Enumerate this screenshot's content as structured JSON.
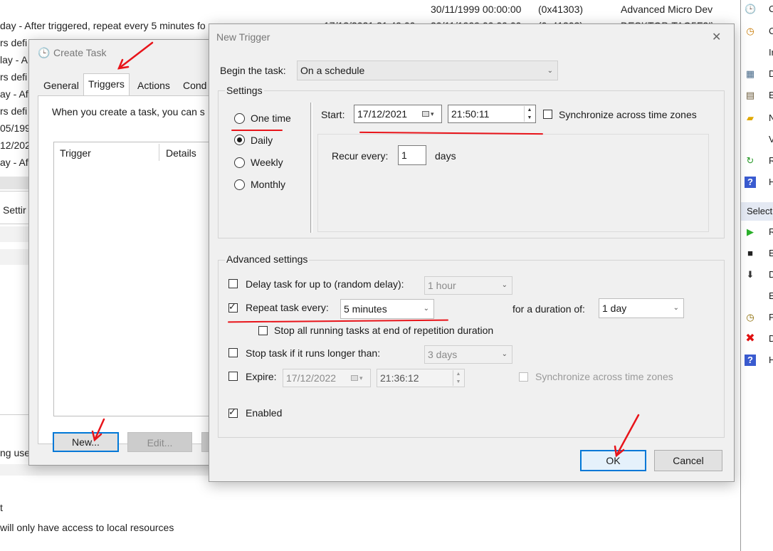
{
  "background": {
    "top_row": {
      "trigger_time": "30/11/1999 00:00:00",
      "result": "(0x41303)",
      "author": "Advanced Micro Dev"
    },
    "row2": {
      "triggers": "day - After triggered, repeat every 5 minutes fo",
      "next_run": "17/12/2021 21:49:00",
      "last_run": "30/11/1999 00:00:00",
      "result": "(0x41303)",
      "author": "DESKTOP-TAQ5F2I\\"
    },
    "left_fragments": [
      "rs defi",
      "lay - A",
      "rs defi",
      "ay - Aft",
      "rs defi",
      "05/199",
      "12/202",
      "ay - Aft"
    ],
    "settings_tab_fragment": "Settir",
    "user_fragment": "ng user",
    "bottom_t": "t",
    "bottom_local": "will only have access to local resources"
  },
  "right_pane": {
    "items": [
      {
        "icon": "clock-icon",
        "text": "C"
      },
      {
        "icon": "task-icon",
        "text": "C"
      },
      {
        "icon": "",
        "text": "Ir"
      },
      {
        "icon": "display-icon",
        "text": "D"
      },
      {
        "icon": "list-icon",
        "text": "E"
      },
      {
        "icon": "folder-icon",
        "text": "N"
      },
      {
        "icon": "",
        "text": "V"
      },
      {
        "icon": "refresh-icon",
        "text": "R"
      },
      {
        "icon": "help-icon",
        "text": "H"
      }
    ],
    "section": "Select",
    "items2": [
      {
        "icon": "run-icon",
        "text": "R"
      },
      {
        "icon": "stop-icon",
        "text": "E"
      },
      {
        "icon": "disable-icon",
        "text": "D"
      },
      {
        "icon": "",
        "text": "E"
      },
      {
        "icon": "properties-icon",
        "text": "P"
      },
      {
        "icon": "delete-icon",
        "text": "D"
      },
      {
        "icon": "help-icon",
        "text": "H"
      }
    ]
  },
  "create_task": {
    "title": "Create Task",
    "tabs": [
      "General",
      "Triggers",
      "Actions",
      "Cond"
    ],
    "active_tab": "Triggers",
    "description": "When you create a task, you can s",
    "columns": [
      "Trigger",
      "Details"
    ],
    "buttons": {
      "new": "New...",
      "edit": "Edit..."
    }
  },
  "new_trigger": {
    "title": "New Trigger",
    "close_glyph": "✕",
    "begin_label": "Begin the task:",
    "begin_value": "On a schedule",
    "settings_label": "Settings",
    "schedule_options": [
      "One time",
      "Daily",
      "Weekly",
      "Monthly"
    ],
    "selected_option": "Daily",
    "start_label": "Start:",
    "start_date": "17/12/2021",
    "start_time": "21:50:11",
    "sync_label": "Synchronize across time zones",
    "recur_label": "Recur every:",
    "recur_value": "1",
    "recur_unit": "days",
    "advanced_label": "Advanced settings",
    "delay_label": "Delay task for up to (random delay):",
    "delay_value": "1 hour",
    "repeat_label": "Repeat task every:",
    "repeat_value": "5 minutes",
    "duration_label": "for a duration of:",
    "duration_value": "1 day",
    "stop_running_label": "Stop all running tasks at end of repetition duration",
    "stop_longer_label": "Stop task if it runs longer than:",
    "stop_longer_value": "3 days",
    "expire_label": "Expire:",
    "expire_date": "17/12/2022",
    "expire_time": "21:36:12",
    "expire_sync_label": "Synchronize across time zones",
    "enabled_label": "Enabled",
    "ok": "OK",
    "cancel": "Cancel"
  },
  "colors": {
    "annotation": "#e8141a",
    "accent": "#0078d7"
  }
}
